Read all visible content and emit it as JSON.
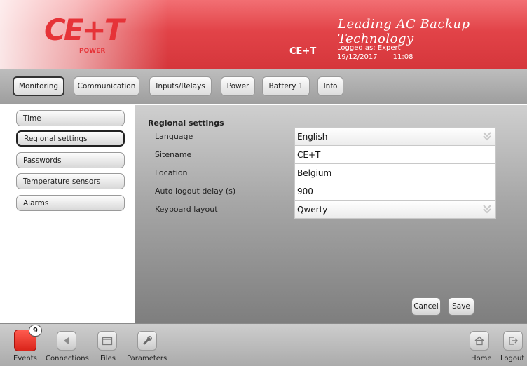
{
  "header": {
    "logo_text": "CE+T",
    "logo_sub": "POWER",
    "tagline": "Leading AC Backup Technology",
    "brand": "CE+T",
    "logged_label": "Logged as: Expert",
    "date": "19/12/2017",
    "time": "11:08"
  },
  "tabs": [
    {
      "label": "Monitoring",
      "active": true
    },
    {
      "label": "Communication",
      "active": false
    },
    {
      "label": "Inputs/Relays",
      "active": false
    },
    {
      "label": "Power",
      "active": false
    },
    {
      "label": "Battery 1",
      "active": false
    },
    {
      "label": "Info",
      "active": false
    }
  ],
  "sidebar": {
    "items": [
      {
        "label": "Time",
        "active": false
      },
      {
        "label": "Regional settings",
        "active": true
      },
      {
        "label": "Passwords",
        "active": false
      },
      {
        "label": "Temperature sensors",
        "active": false
      },
      {
        "label": "Alarms",
        "active": false
      }
    ]
  },
  "main": {
    "section_title": "Regional settings",
    "rows": [
      {
        "label": "Language",
        "value": "English",
        "type": "select"
      },
      {
        "label": "Sitename",
        "value": "CE+T",
        "type": "text"
      },
      {
        "label": "Location",
        "value": "Belgium",
        "type": "text"
      },
      {
        "label": "Auto logout delay (s)",
        "value": "900",
        "type": "text"
      },
      {
        "label": "Keyboard layout",
        "value": "Qwerty",
        "type": "select"
      }
    ],
    "cancel_label": "Cancel",
    "save_label": "Save"
  },
  "bottombar": {
    "events_label": "Events",
    "events_count": "9",
    "connections_label": "Connections",
    "files_label": "Files",
    "parameters_label": "Parameters",
    "home_label": "Home",
    "logout_label": "Logout"
  },
  "colors": {
    "header_red": "#e24348",
    "logo_red": "#e63338",
    "events_red": "#e8332a"
  },
  "icons": {
    "events": "alert-square-icon",
    "connections": "play-arrow-icon",
    "files": "folder-icon",
    "parameters": "wrench-icon",
    "home": "home-icon",
    "logout": "logout-icon",
    "select": "chevron-down-icon"
  }
}
